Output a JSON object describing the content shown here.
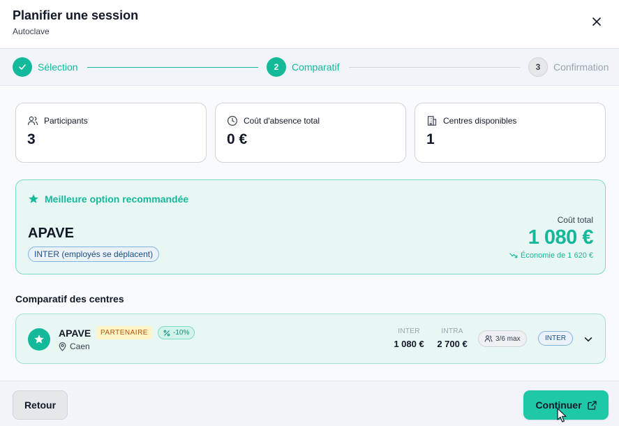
{
  "header": {
    "title": "Planifier une session",
    "subtitle": "Autoclave",
    "close_icon": "close-icon"
  },
  "stepper": {
    "steps": [
      {
        "number": "1",
        "label": "Sélection",
        "state": "done"
      },
      {
        "number": "2",
        "label": "Comparatif",
        "state": "active"
      },
      {
        "number": "3",
        "label": "Confirmation",
        "state": "pending"
      }
    ]
  },
  "stats": [
    {
      "icon": "users-icon",
      "label": "Participants",
      "value": "3"
    },
    {
      "icon": "clock-icon",
      "label": "Coût d'absence total",
      "value": "0 €"
    },
    {
      "icon": "building-icon",
      "label": "Centres disponibles",
      "value": "1"
    }
  ],
  "recommended": {
    "heading": "Meilleure option recommandée",
    "name": "APAVE",
    "mode_badge": "INTER (employés se déplacent)",
    "cost_label": "Coût total",
    "cost_value": "1 080 €",
    "savings": "Économie de 1 620 €"
  },
  "comparison": {
    "section_title": "Comparatif des centres",
    "centers": [
      {
        "name": "APAVE",
        "partner_badge": "PARTENAIRE",
        "discount_badge": "-10%",
        "city": "Caen",
        "inter_label": "INTER",
        "inter_price": "1 080 €",
        "intra_label": "INTRA",
        "intra_price": "2 700 €",
        "capacity": "3/6 max",
        "mode": "INTER"
      }
    ]
  },
  "footer": {
    "back_label": "Retour",
    "continue_label": "Continuer"
  },
  "colors": {
    "accent": "#14b89a",
    "accent_bg": "#e8f7f3",
    "partner_bg": "#fef3c7",
    "partner_text": "#b45309",
    "info_border": "#7fb3e0"
  }
}
